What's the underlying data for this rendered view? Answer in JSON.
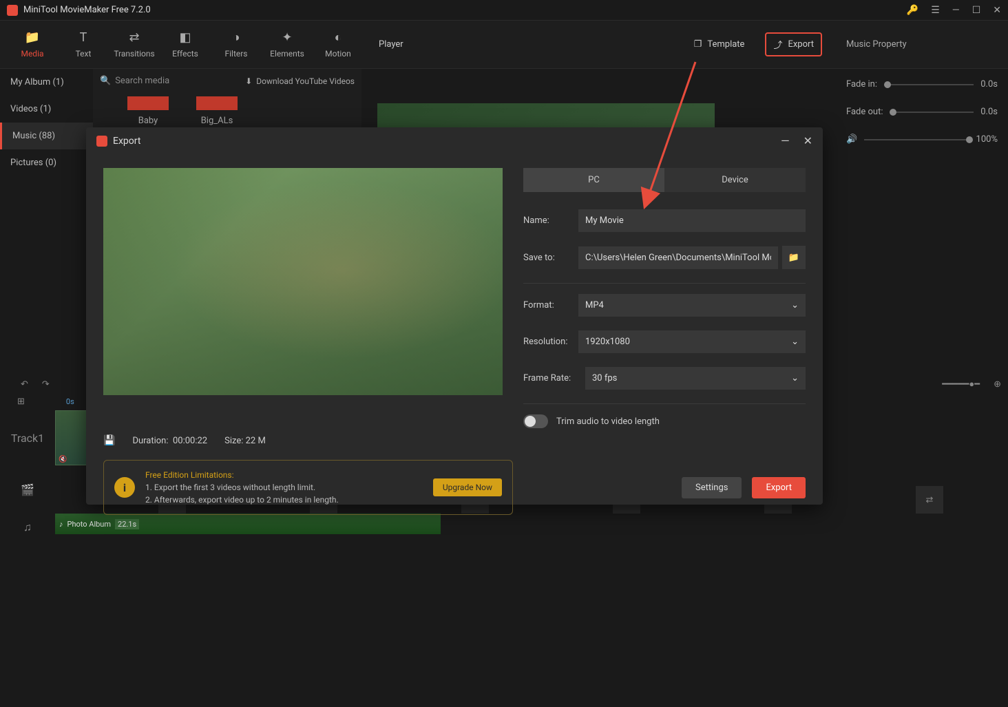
{
  "titlebar": {
    "title": "MiniTool MovieMaker Free 7.2.0"
  },
  "toolbar": {
    "tabs": [
      {
        "label": "Media",
        "active": true
      },
      {
        "label": "Text"
      },
      {
        "label": "Transitions"
      },
      {
        "label": "Effects"
      },
      {
        "label": "Filters"
      },
      {
        "label": "Elements"
      },
      {
        "label": "Motion"
      }
    ],
    "player_label": "Player",
    "template_label": "Template",
    "export_label": "Export",
    "music_property": "Music Property"
  },
  "sidebar": {
    "items": [
      {
        "label": "My Album (1)"
      },
      {
        "label": "Videos (1)"
      },
      {
        "label": "Music (88)",
        "active": true
      },
      {
        "label": "Pictures (0)"
      }
    ]
  },
  "media_panel": {
    "search_placeholder": "Search media",
    "download_label": "Download YouTube Videos",
    "thumbs": [
      {
        "label": "Baby"
      },
      {
        "label": "Big_ALs"
      }
    ]
  },
  "right_panel": {
    "fade_in_label": "Fade in:",
    "fade_in_value": "0.0s",
    "fade_out_label": "Fade out:",
    "fade_out_value": "0.0s",
    "volume_value": "100%"
  },
  "timeline": {
    "time_marker": "0s",
    "track1_label": "Track1",
    "audio_name": "Photo Album",
    "audio_duration": "22.1s"
  },
  "export_dialog": {
    "title": "Export",
    "tabs": {
      "pc": "PC",
      "device": "Device"
    },
    "name_label": "Name:",
    "name_value": "My Movie",
    "saveto_label": "Save to:",
    "saveto_value": "C:\\Users\\Helen Green\\Documents\\MiniTool MovieM",
    "format_label": "Format:",
    "format_value": "MP4",
    "resolution_label": "Resolution:",
    "resolution_value": "1920x1080",
    "framerate_label": "Frame Rate:",
    "framerate_value": "30 fps",
    "trim_label": "Trim audio to video length",
    "duration_label": "Duration:",
    "duration_value": "00:00:22",
    "size_label": "Size:",
    "size_value": "22 M",
    "limitations_head": "Free Edition Limitations:",
    "limitations_line1": "1. Export the first 3 videos without length limit.",
    "limitations_line2": "2. Afterwards, export video up to 2 minutes in length.",
    "upgrade_label": "Upgrade Now",
    "settings_label": "Settings",
    "export_label": "Export"
  }
}
